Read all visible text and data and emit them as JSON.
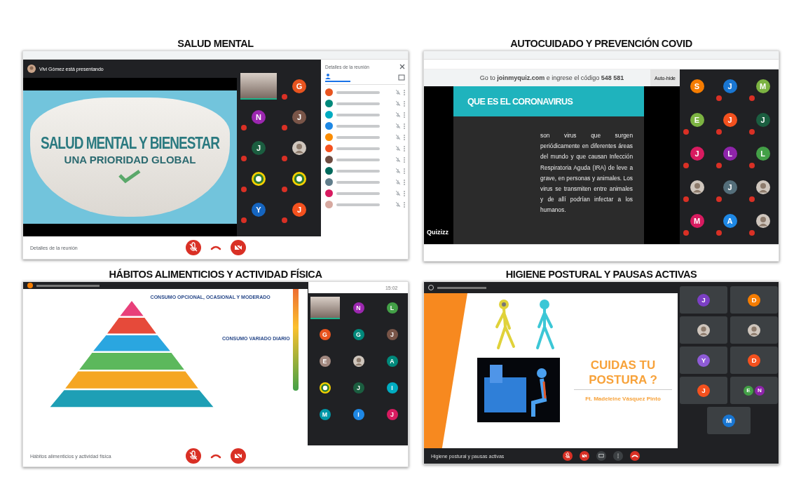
{
  "panels": [
    {
      "kind": "mask",
      "heading": "SALUD MENTAL",
      "presenter": "Vivi Gómez está presentando",
      "slide": {
        "title": "SALUD MENTAL Y BIENESTAR",
        "subtitle": "UNA PRIORIDAD GLOBAL"
      },
      "tiles": [
        {
          "kind": "video",
          "muted": false
        },
        {
          "kind": "avatar",
          "letter": "G",
          "color": "#e8541f",
          "muted": true
        },
        {
          "kind": "avatar",
          "letter": "N",
          "color": "#9c27b0",
          "muted": true
        },
        {
          "kind": "avatar",
          "letter": "J",
          "color": "#795548",
          "muted": true
        },
        {
          "kind": "avatar",
          "letter": "J",
          "color": "#1b5e40",
          "muted": true
        },
        {
          "kind": "photo",
          "muted": true
        },
        {
          "kind": "emblem",
          "muted": true
        },
        {
          "kind": "emblem",
          "muted": true
        },
        {
          "kind": "avatar",
          "letter": "Y",
          "color": "#1565c0",
          "muted": true
        },
        {
          "kind": "avatar",
          "letter": "J",
          "color": "#f4511e",
          "muted": true
        }
      ],
      "sidebar": {
        "title": "Detalles de la reunión",
        "people": [
          {
            "color": "#e8541f"
          },
          {
            "color": "#00897b"
          },
          {
            "color": "#00acc1"
          },
          {
            "color": "#1e88e5"
          },
          {
            "color": "#fb8c00"
          },
          {
            "color": "#f4511e"
          },
          {
            "color": "#6d4c41"
          },
          {
            "color": "#00695c"
          },
          {
            "color": "#607d8b"
          },
          {
            "color": "#d81b60"
          },
          {
            "color": "#d7a9a0"
          }
        ]
      },
      "footer": "Detalles de la reunión",
      "controls": [
        {
          "kind": "mic"
        },
        {
          "kind": "hangup"
        },
        {
          "kind": "camera"
        }
      ]
    },
    {
      "kind": "quiz",
      "heading": "AUTOCUIDADO Y PREVENCIÓN COVID",
      "banner": "Go to **joinmyquiz.com** e ingrese el código **548 581**",
      "auto_hide": "Auto-hide",
      "slide": {
        "title": "QUE ES EL CORONAVIRUS",
        "body": "son virus que surgen periódicamente en diferentes áreas del mundo y que causan Infección Respiratoria Aguda (IRA) de leve a grave, en personas y animales. Los virus se transmiten entre animales y de allí podrían infectar a los humanos.",
        "brand": "Quizizz"
      },
      "tiles": [
        {
          "kind": "avatar",
          "letter": "S",
          "color": "#f57c00",
          "muted": false
        },
        {
          "kind": "avatar",
          "letter": "J",
          "color": "#1976d2",
          "muted": true
        },
        {
          "kind": "avatar",
          "letter": "M",
          "color": "#7cb342",
          "muted": true
        },
        {
          "kind": "avatar",
          "letter": "E",
          "color": "#7cb342",
          "muted": true
        },
        {
          "kind": "avatar",
          "letter": "J",
          "color": "#f4511e",
          "muted": true
        },
        {
          "kind": "avatar",
          "letter": "J",
          "color": "#1b5e40",
          "muted": true
        },
        {
          "kind": "avatar",
          "letter": "J",
          "color": "#d81b60",
          "muted": true
        },
        {
          "kind": "avatar",
          "letter": "L",
          "color": "#8e24aa",
          "muted": true
        },
        {
          "kind": "avatar",
          "letter": "L",
          "color": "#43a047",
          "muted": true
        },
        {
          "kind": "photo",
          "muted": true
        },
        {
          "kind": "avatar",
          "letter": "J",
          "color": "#546e7a",
          "muted": true
        },
        {
          "kind": "photo",
          "muted": true
        },
        {
          "kind": "avatar",
          "letter": "M",
          "color": "#d81b60",
          "muted": true
        },
        {
          "kind": "avatar",
          "letter": "A",
          "color": "#1e88e5",
          "muted": true
        },
        {
          "kind": "photo",
          "muted": true
        }
      ]
    },
    {
      "kind": "pyramid",
      "heading": "HÁBITOS ALIMENTICIOS Y ACTIVIDAD FÍSICA",
      "clock": "15:02",
      "slide": {
        "top_label": "CONSUMO OPCIONAL, OCASIONAL Y MODERADO",
        "mid_label": "CONSUMO VARIADO DIARIO"
      },
      "tiles": [
        {
          "kind": "video"
        },
        {
          "kind": "avatar",
          "letter": "N",
          "color": "#9c27b0"
        },
        {
          "kind": "avatar",
          "letter": "L",
          "color": "#43a047"
        },
        {
          "kind": "avatar",
          "letter": "G",
          "color": "#e8541f"
        },
        {
          "kind": "avatar",
          "letter": "G",
          "color": "#00897b"
        },
        {
          "kind": "avatar",
          "letter": "J",
          "color": "#795548"
        },
        {
          "kind": "avatar",
          "letter": "E",
          "color": "#a1887f"
        },
        {
          "kind": "photo"
        },
        {
          "kind": "avatar",
          "letter": "A",
          "color": "#00897b"
        },
        {
          "kind": "emblem"
        },
        {
          "kind": "avatar",
          "letter": "J",
          "color": "#1b5e40"
        },
        {
          "kind": "avatar",
          "letter": "I",
          "color": "#00acc1"
        },
        {
          "kind": "avatar",
          "letter": "M",
          "color": "#0097a7"
        },
        {
          "kind": "avatar",
          "letter": "I",
          "color": "#1e88e5"
        },
        {
          "kind": "avatar",
          "letter": "J",
          "color": "#d81b60"
        }
      ],
      "footer": "Hábitos alimenticios y actividad física",
      "controls": [
        {
          "kind": "mic"
        },
        {
          "kind": "hangup"
        },
        {
          "kind": "camera"
        }
      ]
    },
    {
      "kind": "posture",
      "heading": "HIGIENE POSTURAL Y PAUSAS ACTIVAS",
      "slide": {
        "title": "CUIDAS TU POSTURA ?",
        "author": "Ft. Madeleine Vásquez Pinto"
      },
      "tiles": [
        {
          "kind": "avatar",
          "letter": "J",
          "color": "#7b3fc4"
        },
        {
          "kind": "avatar",
          "letter": "D",
          "color": "#f57c00"
        },
        {
          "kind": "photo"
        },
        {
          "kind": "photo"
        },
        {
          "kind": "avatar",
          "letter": "Y",
          "color": "#8e5bd6"
        },
        {
          "kind": "avatar",
          "letter": "D",
          "color": "#f4511e"
        },
        {
          "kind": "avatar",
          "letter": "J",
          "color": "#f4511e"
        },
        {
          "kind": "group",
          "members": [
            {
              "letter": "E",
              "color": "#43a047"
            },
            {
              "letter": "N",
              "color": "#8e24aa"
            }
          ]
        },
        {
          "kind": "avatar",
          "letter": "M",
          "color": "#1976d2"
        }
      ],
      "footer": "Higiene postural y pausas activas",
      "controls": [
        {
          "kind": "mic"
        },
        {
          "kind": "camera"
        },
        {
          "kind": "share"
        },
        {
          "kind": "more"
        },
        {
          "kind": "hangup"
        }
      ]
    }
  ]
}
